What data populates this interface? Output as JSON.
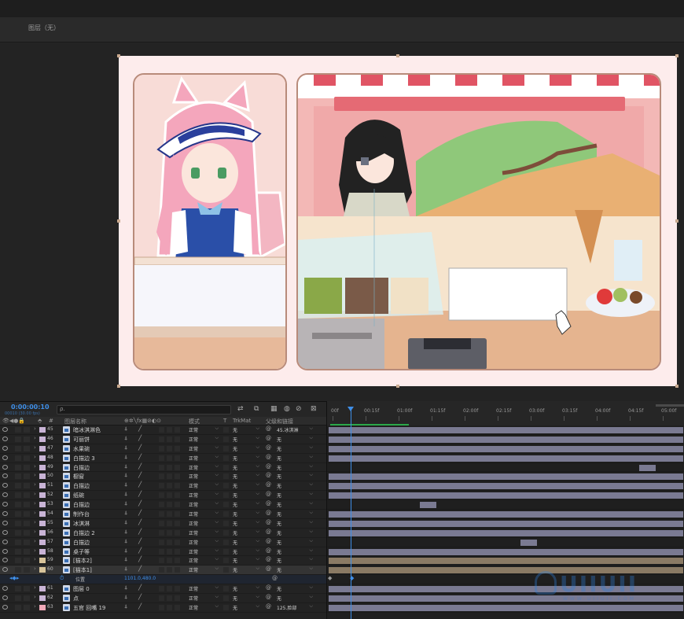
{
  "viewer": {
    "title": "图层（无）"
  },
  "timeline": {
    "timecode": "0:00:00:10",
    "fps_label": "00010 (30.00 fps)",
    "search_placeholder": "ρ.",
    "columns": {
      "layer_name": "图层名称",
      "mode": "模式",
      "t": "T",
      "trkmat": "TrkMat",
      "parent": "父级和链接"
    },
    "ruler_ticks": [
      "00f",
      "00:15f",
      "01:00f",
      "01:15f",
      "02:00f",
      "02:15f",
      "03:00f",
      "03:15f",
      "04:00f",
      "04:15f",
      "05:00f"
    ],
    "layers": [
      {
        "num": "45",
        "name": "暗冰淇淋色",
        "color": "#c9b4d6",
        "mode": "正常",
        "trkmat": "无",
        "parent": "45.冰淇淋"
      },
      {
        "num": "46",
        "name": "可丽饼",
        "color": "#c9b4d6",
        "mode": "正常",
        "trkmat": "无",
        "parent": "无"
      },
      {
        "num": "47",
        "name": "水果碗",
        "color": "#c9b4d6",
        "mode": "正常",
        "trkmat": "无",
        "parent": "无"
      },
      {
        "num": "48",
        "name": "白描边 3",
        "color": "#c9b4d6",
        "mode": "正常",
        "trkmat": "无",
        "parent": "无"
      },
      {
        "num": "49",
        "name": "白描边",
        "color": "#c9b4d6",
        "mode": "正常",
        "trkmat": "无",
        "parent": "无"
      },
      {
        "num": "50",
        "name": "橱窗",
        "color": "#c9b4d6",
        "mode": "正常",
        "trkmat": "无",
        "parent": "无"
      },
      {
        "num": "51",
        "name": "白描边",
        "color": "#c9b4d6",
        "mode": "正常",
        "trkmat": "无",
        "parent": "无"
      },
      {
        "num": "52",
        "name": "纸碗",
        "color": "#c9b4d6",
        "mode": "正常",
        "trkmat": "无",
        "parent": "无"
      },
      {
        "num": "53",
        "name": "白描边",
        "color": "#c9b4d6",
        "mode": "正常",
        "trkmat": "无",
        "parent": "无"
      },
      {
        "num": "54",
        "name": "制作台",
        "color": "#c9b4d6",
        "mode": "正常",
        "trkmat": "无",
        "parent": "无"
      },
      {
        "num": "55",
        "name": "冰淇淋",
        "color": "#c9b4d6",
        "mode": "正常",
        "trkmat": "无",
        "parent": "无"
      },
      {
        "num": "56",
        "name": "白描边 2",
        "color": "#c9b4d6",
        "mode": "正常",
        "trkmat": "无",
        "parent": "无"
      },
      {
        "num": "57",
        "name": "白描边",
        "color": "#c9b4d6",
        "mode": "正常",
        "trkmat": "无",
        "parent": "无"
      },
      {
        "num": "58",
        "name": "桌子等",
        "color": "#c9b4d6",
        "mode": "正常",
        "trkmat": "无",
        "parent": "无"
      },
      {
        "num": "59",
        "name": "[猫本2]",
        "color": "#d8c49a",
        "mode": "正常",
        "trkmat": "无",
        "parent": "无"
      },
      {
        "num": "60",
        "name": "[猫本1]",
        "color": "#d8c49a",
        "mode": "正常",
        "trkmat": "无",
        "parent": "无"
      },
      {
        "num": "61",
        "name": "图层 0",
        "color": "#c9b4d6",
        "mode": "正常",
        "trkmat": "无",
        "parent": "无"
      },
      {
        "num": "62",
        "name": "点",
        "color": "#c9b4d6",
        "mode": "正常",
        "trkmat": "无",
        "parent": "无"
      },
      {
        "num": "63",
        "name": "五官 回嘴 19",
        "color": "#f0a8b8",
        "mode": "正常",
        "trkmat": "无",
        "parent": "125.脸部"
      }
    ],
    "property": {
      "name": "位置",
      "value": "1101.0,480.0"
    }
  },
  "watermark": {
    "text": "UIIUII",
    "sub": "WWW.UIIUII.COM"
  },
  "colors": {
    "accent": "#3f8fe8",
    "bg": "#232323",
    "track": "#7a7a92",
    "green": "#2ba84a"
  }
}
